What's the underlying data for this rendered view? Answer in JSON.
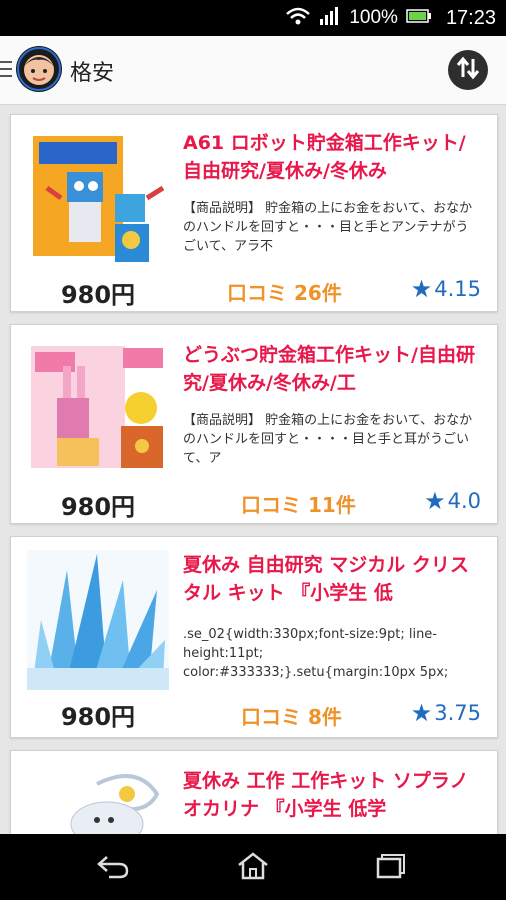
{
  "status_bar": {
    "battery": "100%",
    "time": "17:23"
  },
  "app_bar": {
    "title": "格安"
  },
  "products": [
    {
      "title": "A61 ロボット貯金箱工作キット/自由研究/夏休み/冬休み",
      "description": "【商品説明】 貯金箱の上にお金をおいて、おなかのハンドルを回すと・・・目と手とアンテナがうごいて、アラ不",
      "price": "980円",
      "review_label": "口コミ",
      "review_count": "26",
      "review_suffix": "件",
      "rating": "4.15"
    },
    {
      "title": "どうぶつ貯金箱工作キット/自由研究/夏休み/冬休み/工",
      "description": "【商品説明】 貯金箱の上にお金をおいて、おなかのハンドルを回すと・・・・目と手と耳がうごいて、ア",
      "price": "980円",
      "review_label": "口コミ",
      "review_count": "11",
      "review_suffix": "件",
      "rating": "4.0"
    },
    {
      "title": "夏休み 自由研究 マジカル クリスタル キット 『小学生 低",
      "description": ".se_02{width:330px;font-size:9pt; line-height:11pt; color:#333333;}.setu{margin:10px 5px;",
      "price": "980円",
      "review_label": "口コミ",
      "review_count": "8",
      "review_suffix": "件",
      "rating": "3.75"
    },
    {
      "title": "夏休み 工作 工作キット ソプラノ オカリナ 『小学生 低学",
      "description": "",
      "price": "",
      "review_label": "",
      "review_count": "",
      "review_suffix": "",
      "rating": ""
    }
  ],
  "colors": {
    "title": "#e8184a",
    "review": "#f0922a",
    "rating": "#1f6bbf"
  },
  "icons": [
    "wifi-icon",
    "signal-icon",
    "battery-icon",
    "menu-icon",
    "avatar",
    "sort-icon",
    "back-icon",
    "home-icon",
    "recent-apps-icon",
    "star-icon"
  ]
}
